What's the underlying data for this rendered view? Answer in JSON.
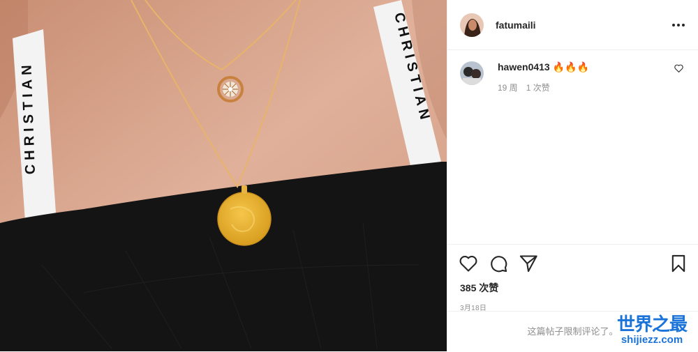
{
  "post": {
    "author": "fatumaili",
    "image_icon": "photo-necklaces"
  },
  "comment": {
    "user": "hawen0413",
    "text": "🔥🔥🔥",
    "age": "19 周",
    "likes": "1 次赞"
  },
  "actions": {
    "likes": "385 次赞",
    "date": "3月18日"
  },
  "footer": {
    "restricted": "这篇帖子限制评论了。"
  },
  "watermark": {
    "cn": "世界之最",
    "url": "shijiezz.com"
  },
  "strap_text": "CHRISTIAN",
  "colors": {
    "skin": "#d9a88c",
    "top": "#141414",
    "gold": "#e6b337",
    "watermark": "#1a73d9"
  }
}
